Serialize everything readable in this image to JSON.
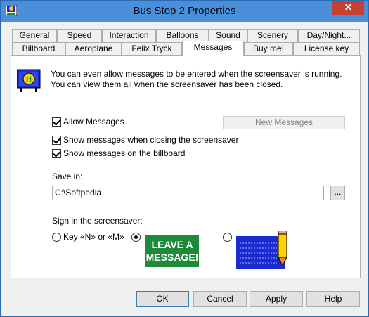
{
  "window": {
    "title": "Bus Stop 2 Properties",
    "close_glyph": "✕"
  },
  "tabs_row1": [
    "General",
    "Speed",
    "Interaction",
    "Balloons",
    "Sound",
    "Scenery",
    "Day/Night..."
  ],
  "tabs_row2": [
    "Billboard",
    "Aeroplane",
    "Felix Tryck",
    "Messages",
    "Buy me!",
    "License key"
  ],
  "active_tab": "Messages",
  "panel": {
    "description": "You can even allow messages to be entered when the screensaver is running. You can view them all when the screensaver has been closed.",
    "allow_messages": {
      "label": "Allow Messages",
      "checked": true
    },
    "show_on_close": {
      "label": "Show messages when closing the screensaver",
      "checked": true
    },
    "show_on_billboard": {
      "label": "Show messages on the billboard",
      "checked": true
    },
    "new_messages_button": "New Messages",
    "save_in_label": "Save in:",
    "save_in_value": "C:\\Softpedia",
    "browse_button": "...",
    "sign_label": "Sign in the screensaver:",
    "radio_key_label": "Key «N» or «M»",
    "sign_image_text": "LEAVE A MESSAGE!",
    "selected_option": "leave-a-message"
  },
  "footer": {
    "ok": "OK",
    "cancel": "Cancel",
    "apply": "Apply",
    "help": "Help"
  },
  "colors": {
    "titlebar": "#4a8fd9",
    "close": "#c7402f",
    "sign_green": "#1d8a3a",
    "board_blue": "#1a2bd1"
  }
}
